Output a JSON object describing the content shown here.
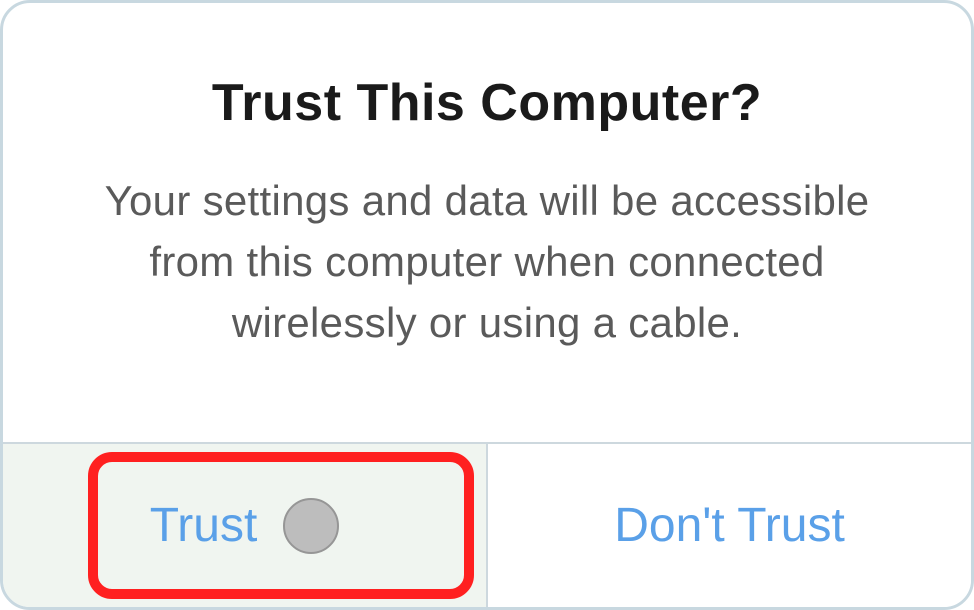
{
  "dialog": {
    "title": "Trust This Computer?",
    "message": "Your settings and data will be accessible from this computer when connected wirelessly or using a cable.",
    "buttons": {
      "trust": "Trust",
      "dont_trust": "Don't Trust"
    }
  }
}
